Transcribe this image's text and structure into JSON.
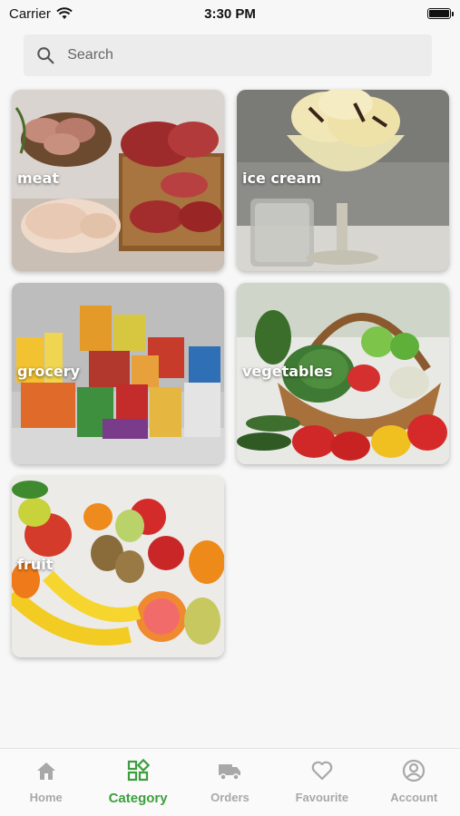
{
  "status": {
    "carrier": "Carrier",
    "time": "3:30 PM"
  },
  "search": {
    "placeholder": "Search"
  },
  "categories": [
    {
      "label": "meat"
    },
    {
      "label": "ice cream"
    },
    {
      "label": "grocery"
    },
    {
      "label": "vegetables"
    },
    {
      "label": "fruit"
    }
  ],
  "tabs": [
    {
      "label": "Home",
      "icon": "home-icon"
    },
    {
      "label": "Category",
      "icon": "category-icon",
      "active": true
    },
    {
      "label": "Orders",
      "icon": "truck-icon"
    },
    {
      "label": "Favourite",
      "icon": "heart-icon"
    },
    {
      "label": "Account",
      "icon": "account-icon"
    }
  ],
  "colors": {
    "accent": "#3d9e3d",
    "inactive": "#a8a8a8"
  }
}
